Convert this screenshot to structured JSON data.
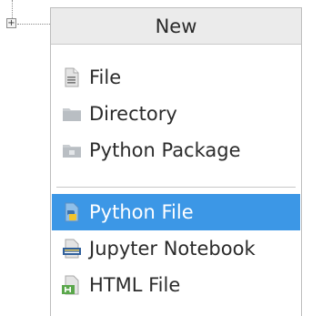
{
  "menu": {
    "title": "New",
    "items": [
      {
        "label": "File",
        "icon": "file-icon",
        "selected": false
      },
      {
        "label": "Directory",
        "icon": "folder-icon",
        "selected": false
      },
      {
        "label": "Python Package",
        "icon": "package-icon",
        "selected": false
      },
      {
        "label": "Python File",
        "icon": "python-file-icon",
        "selected": true
      },
      {
        "label": "Jupyter Notebook",
        "icon": "jupyter-notebook-icon",
        "selected": false
      },
      {
        "label": "HTML File",
        "icon": "html-file-icon",
        "selected": false
      }
    ]
  },
  "tree": {
    "expander_glyph": "+"
  },
  "colors": {
    "highlight": "#3c97e6",
    "header_bg": "#ebebeb"
  }
}
